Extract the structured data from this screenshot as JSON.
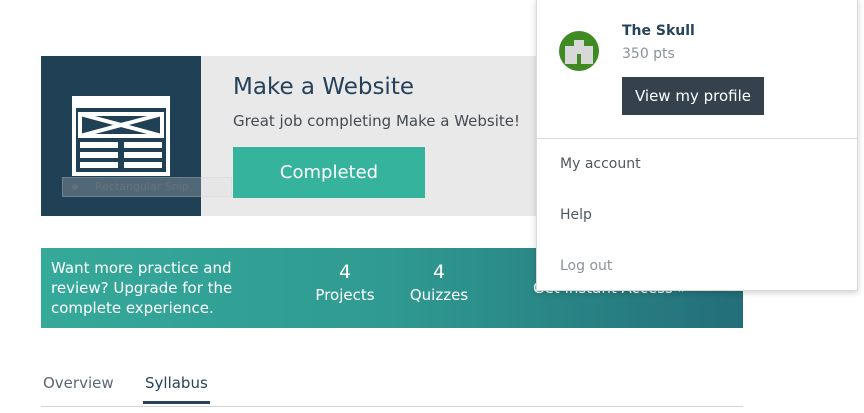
{
  "course": {
    "title": "Make a Website",
    "subtitle": "Great job completing Make a Website!",
    "status_button": "Completed",
    "thumbnail_icon": "website-wireframe-icon",
    "snip_overlay_label": "Rectangular Snip"
  },
  "upgrade": {
    "text": "Want more practice and review? Upgrade for the complete experience.",
    "stats": [
      {
        "value": "4",
        "label": "Projects"
      },
      {
        "value": "4",
        "label": "Quizzes"
      }
    ],
    "cta": "Get Instant Access »"
  },
  "tabs": [
    {
      "label": "Overview",
      "active": false
    },
    {
      "label": "Syllabus",
      "active": true
    }
  ],
  "user_menu": {
    "username": "The Skull",
    "points": "350 pts",
    "avatar_icon": "avatar-icon",
    "view_profile": "View my profile",
    "items": [
      {
        "label": "My account"
      },
      {
        "label": "Help"
      },
      {
        "label": "Log out"
      }
    ]
  },
  "colors": {
    "thumb_bg": "#204056",
    "completed_green": "#36b39d",
    "profile_button": "#35424e",
    "avatar_green": "#3f8a22"
  }
}
